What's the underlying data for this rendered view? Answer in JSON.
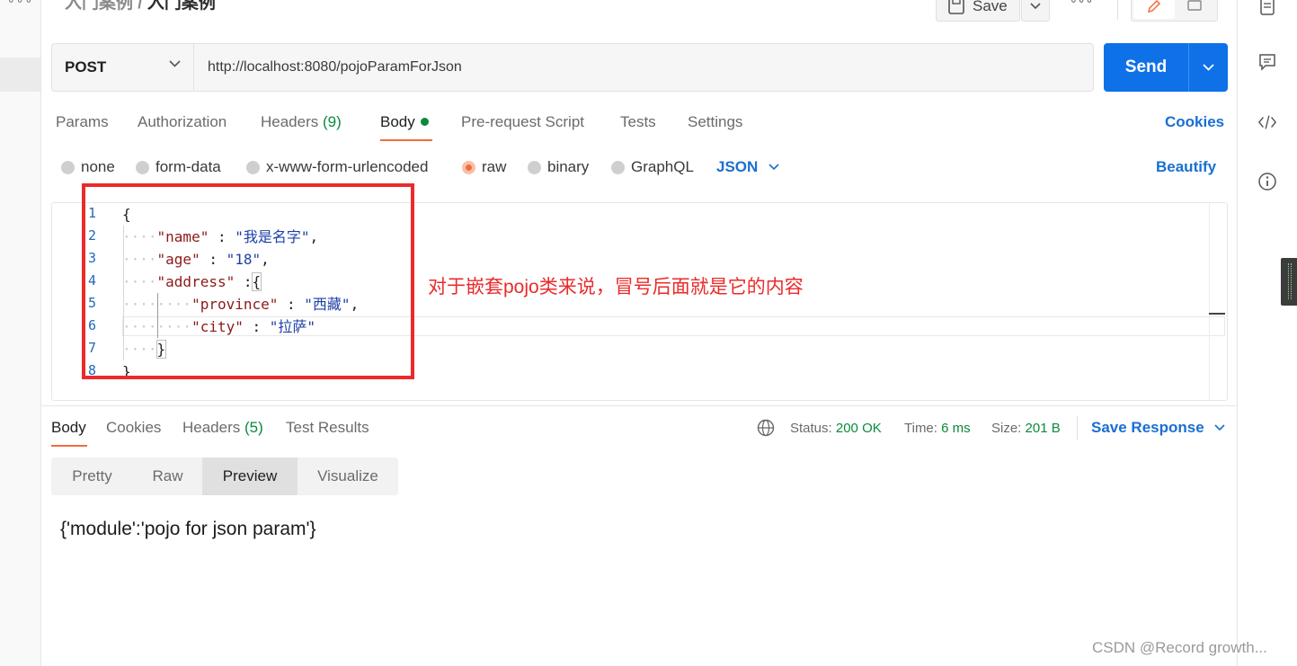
{
  "breadcrumb": {
    "parent": "入门案例",
    "separator": "/",
    "current": "入门案例"
  },
  "toolbar": {
    "save_label": "Save"
  },
  "request": {
    "method": "POST",
    "url": "http://localhost:8080/pojoParamForJson",
    "send_label": "Send"
  },
  "request_tabs": [
    {
      "label": "Params"
    },
    {
      "label": "Authorization"
    },
    {
      "label": "Headers",
      "count": "(9)"
    },
    {
      "label": "Body"
    },
    {
      "label": "Pre-request Script"
    },
    {
      "label": "Tests"
    },
    {
      "label": "Settings"
    }
  ],
  "cookies_link": "Cookies",
  "body_types": [
    "none",
    "form-data",
    "x-www-form-urlencoded",
    "raw",
    "binary",
    "GraphQL"
  ],
  "selected_body_type": "raw",
  "raw_format": "JSON",
  "beautify_label": "Beautify",
  "editor": {
    "line_numbers": [
      "1",
      "2",
      "3",
      "4",
      "5",
      "6",
      "7",
      "8"
    ],
    "l1": "{",
    "l2_key": "\"name\"",
    "l2_sep": " : ",
    "l2_val": "\"我是名字\"",
    "l2_end": ",",
    "l3_key": "\"age\"",
    "l3_sep": " : ",
    "l3_val": "\"18\"",
    "l3_end": ",",
    "l4_key": "\"address\"",
    "l4_sep": " :",
    "l4_val": "{",
    "l5_key": "\"province\"",
    "l5_sep": " : ",
    "l5_val": "\"西藏\"",
    "l5_end": ",",
    "l6_key": "\"city\"",
    "l6_sep": " : ",
    "l6_val": "\"拉萨\"",
    "l7": "}",
    "l8": "}"
  },
  "annotation": "对于嵌套pojo类来说，冒号后面就是它的内容",
  "response_tabs": [
    {
      "label": "Body"
    },
    {
      "label": "Cookies"
    },
    {
      "label": "Headers",
      "count": "(5)"
    },
    {
      "label": "Test Results"
    }
  ],
  "response_meta": {
    "status_label": "Status:",
    "status_value": "200 OK",
    "time_label": "Time:",
    "time_value": "6 ms",
    "size_label": "Size:",
    "size_value": "201 B",
    "save_response": "Save Response"
  },
  "view_tabs": [
    "Pretty",
    "Raw",
    "Preview",
    "Visualize"
  ],
  "active_view_tab": "Preview",
  "preview_text": "{'module':'pojo for json param'}",
  "watermark": "CSDN @Record growth...",
  "colors": {
    "accent": "#f26b3a",
    "send_blue": "#0f71e8",
    "link_blue": "#1a6fd1",
    "success_green": "#0b8a3b",
    "annotation_red": "#ec2a2a"
  }
}
